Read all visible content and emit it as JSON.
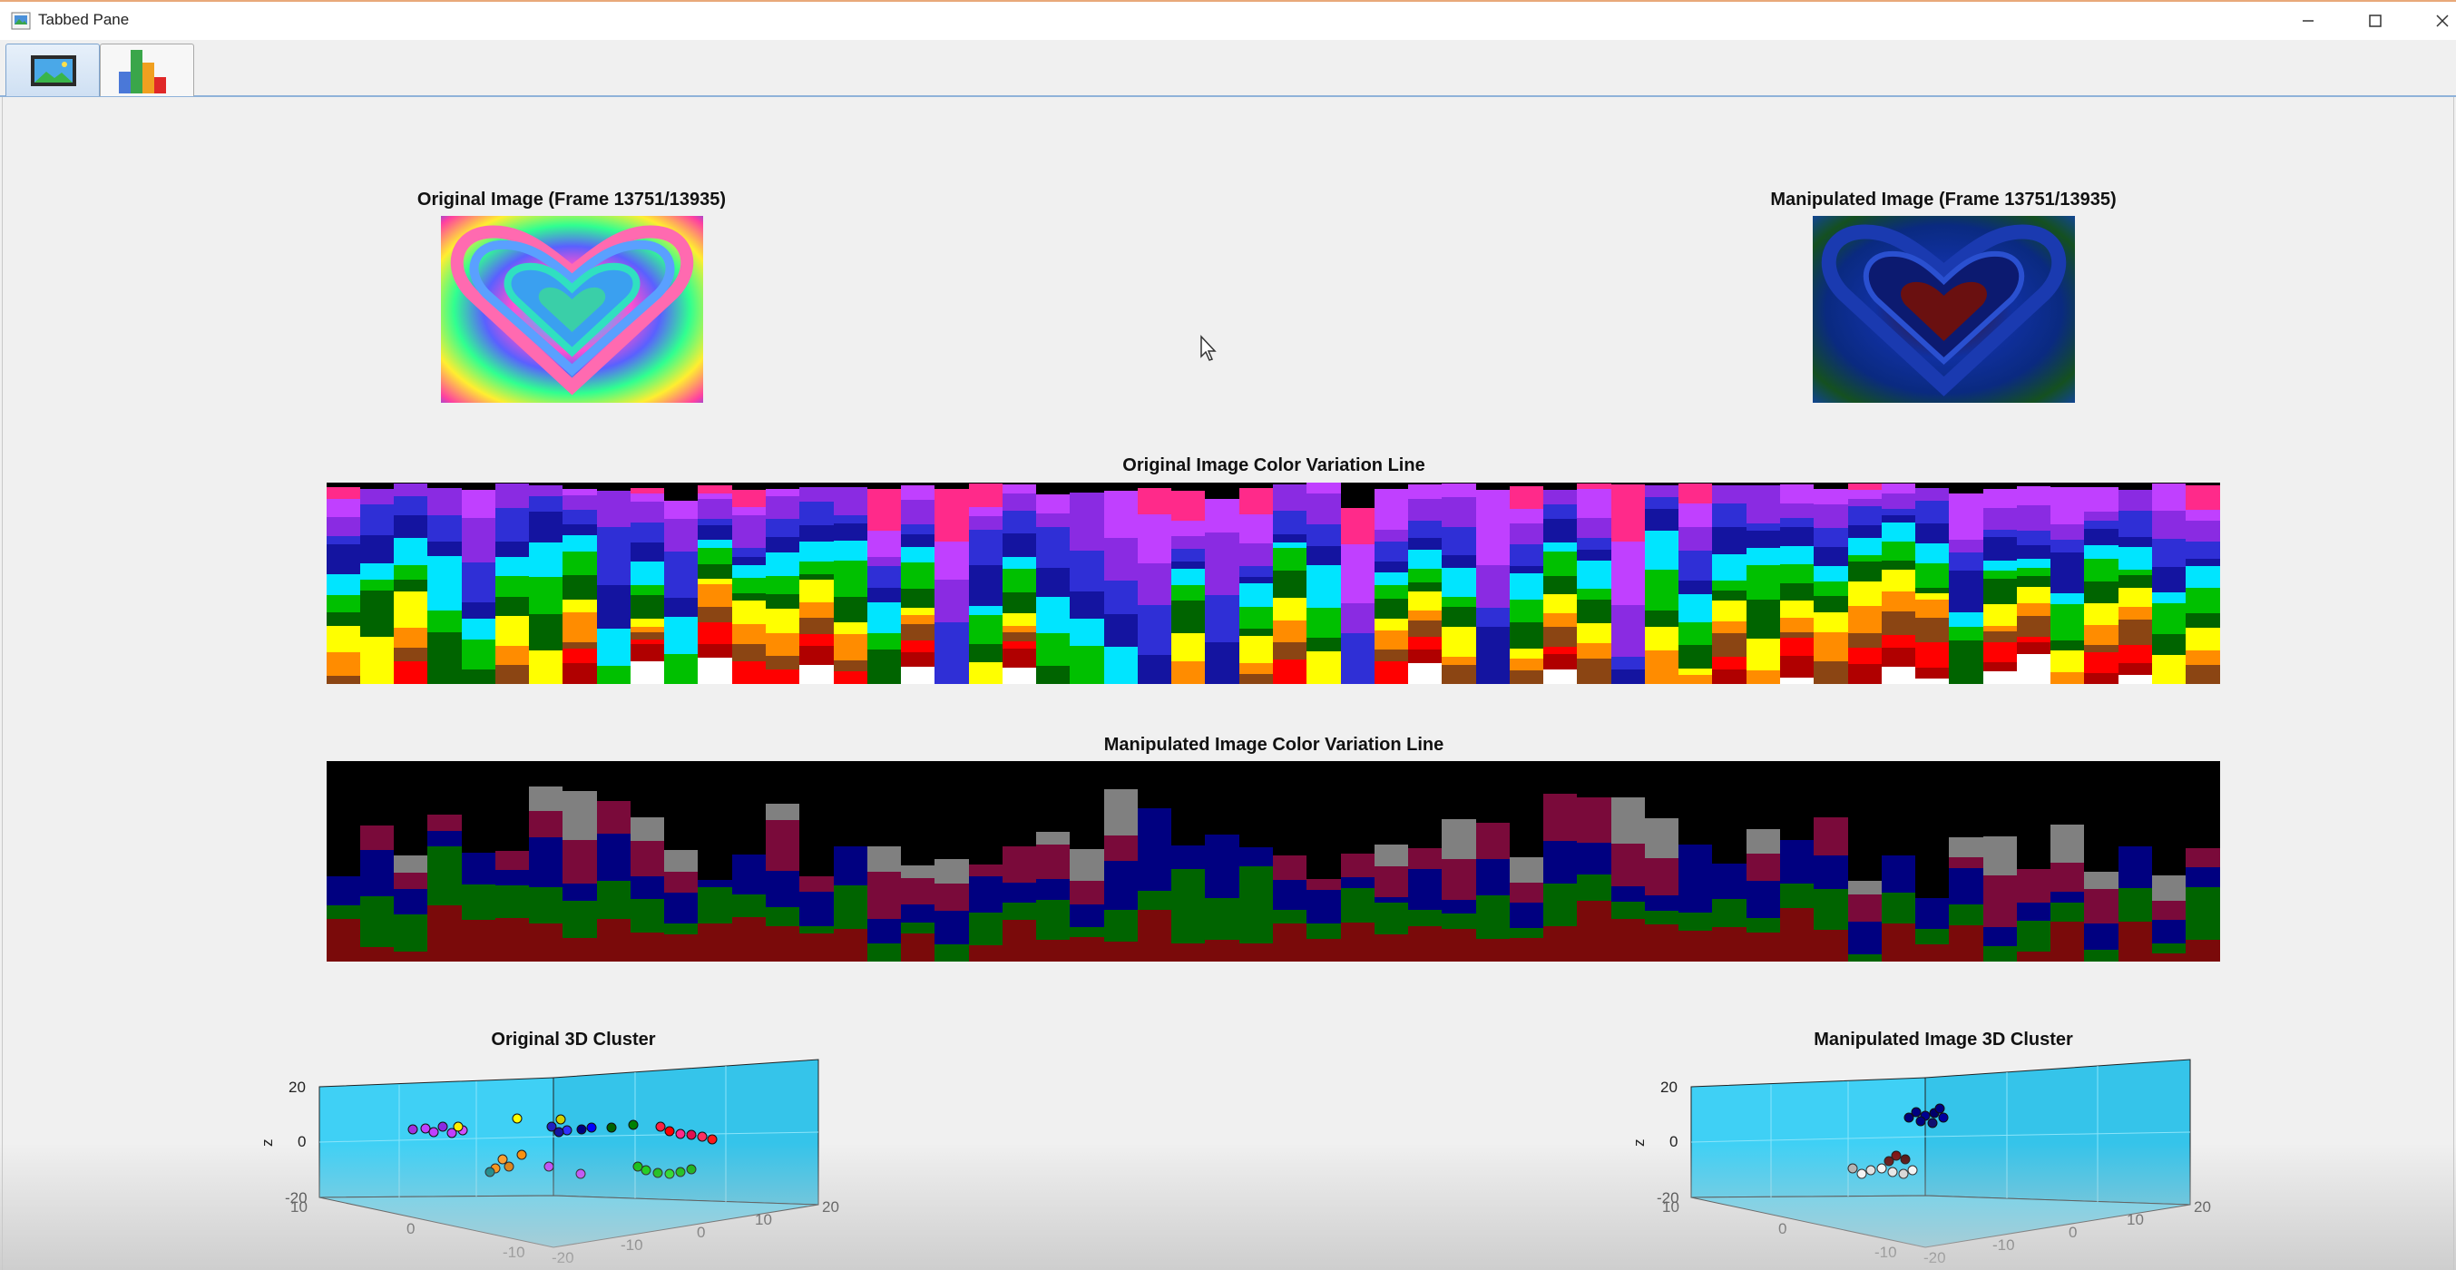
{
  "window": {
    "title": "Tabbed Pane",
    "controls": [
      "minimize-icon",
      "maximize-icon",
      "close-icon"
    ]
  },
  "tabs": [
    {
      "icon": "image-icon",
      "selected": true
    },
    {
      "icon": "bar-chart-icon",
      "selected": false
    }
  ],
  "panels": {
    "original_image_title": "Original Image (Frame 13751/13935)",
    "manipulated_image_title": "Manipulated Image (Frame 13751/13935)",
    "original_line_title": "Original Image Color Variation Line",
    "manipulated_line_title": "Manipulated Image Color Variation Line",
    "original_cluster_title": "Original 3D Cluster",
    "manipulated_cluster_title": "Manipulated Image 3D Cluster"
  },
  "cluster_axes": {
    "z_label": "z",
    "z_ticks": [
      "20",
      "0",
      "-20"
    ],
    "front_ticks": [
      "10",
      "0",
      "-10"
    ],
    "right_ticks": [
      "-20",
      "-10",
      "0",
      "10",
      "20"
    ]
  },
  "colors": {
    "plot_background": "#3fd0f5",
    "original_palette": [
      "#ff2a8a",
      "#c040ff",
      "#8a2be2",
      "#2f2fd6",
      "#1414a0",
      "#00e5ff",
      "#00c000",
      "#006400",
      "#ffff00",
      "#ff8c00",
      "#8b4513",
      "#ff0000",
      "#b00000",
      "#ffffff"
    ],
    "manipulated_palette": [
      "#000000",
      "#808080",
      "#7a0a3a",
      "#000080",
      "#006400",
      "#7a0a0a"
    ]
  }
}
